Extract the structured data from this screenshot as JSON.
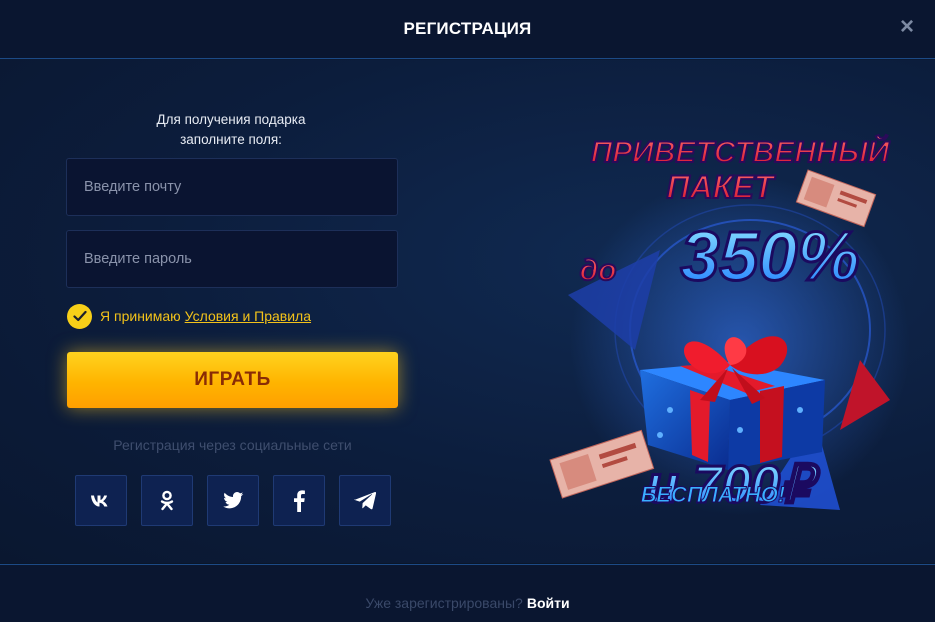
{
  "header": {
    "title": "РЕГИСТРАЦИЯ",
    "close_icon": "close-icon"
  },
  "form": {
    "intro_line1": "Для получения подарка",
    "intro_line2": "заполните поля:",
    "email_placeholder": "Введите почту",
    "password_placeholder": "Введите пароль",
    "accept_text": "Я принимаю",
    "terms_link": "Условия и Правила",
    "accept_checked": true,
    "play_label": "ИГРАТЬ",
    "social_label": "Регистрация через социальные сети",
    "socials": [
      {
        "name": "vk-icon",
        "label": "vk"
      },
      {
        "name": "odnoklassniki-icon",
        "label": "ok"
      },
      {
        "name": "twitter-icon",
        "label": "twitter"
      },
      {
        "name": "facebook-icon",
        "label": "f"
      },
      {
        "name": "telegram-icon",
        "label": "telegram"
      }
    ]
  },
  "promo": {
    "line1": "ПРИВЕТСТВЕННЫЙ",
    "line2": "ПАКЕТ",
    "line3_prefix": "до",
    "line3_value": "350%",
    "line4": "и 700₽",
    "line5": "БЕСПЛАТНО!"
  },
  "footer": {
    "question": "Уже зарегистрированы?",
    "login": "Войти"
  },
  "colors": {
    "accent_yellow": "#ffc107",
    "promo_red": "#e8203a",
    "promo_blue": "#2aa8ff",
    "bg": "#0c1b35"
  }
}
